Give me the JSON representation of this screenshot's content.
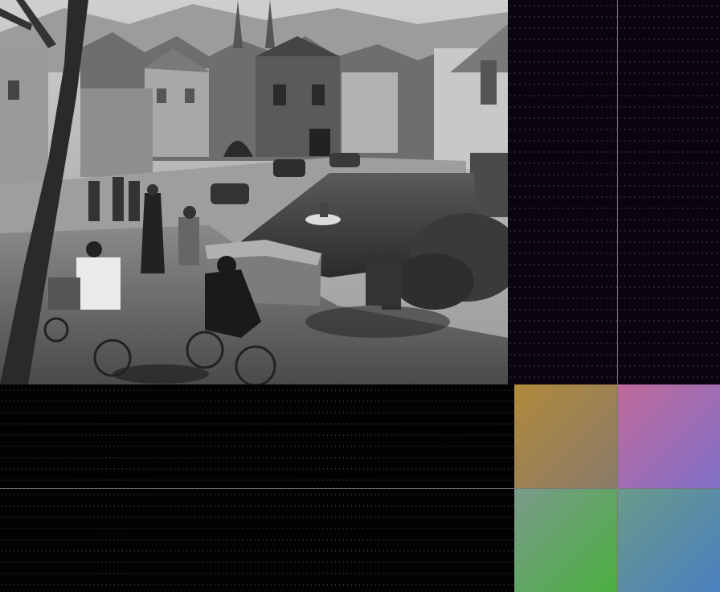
{
  "colors": {
    "grad_tl": "#b08a3a",
    "grad_tl_end": "#8a7a6a",
    "grad_tr": "#c06a9a",
    "grad_tr_end": "#8070c8",
    "grad_bl": "#4ab040",
    "grad_bl_end": "#7a9a8a",
    "grad_br": "#6a9a8a",
    "grad_br_end": "#4a80c0",
    "dark_panel": "#0a0412"
  }
}
